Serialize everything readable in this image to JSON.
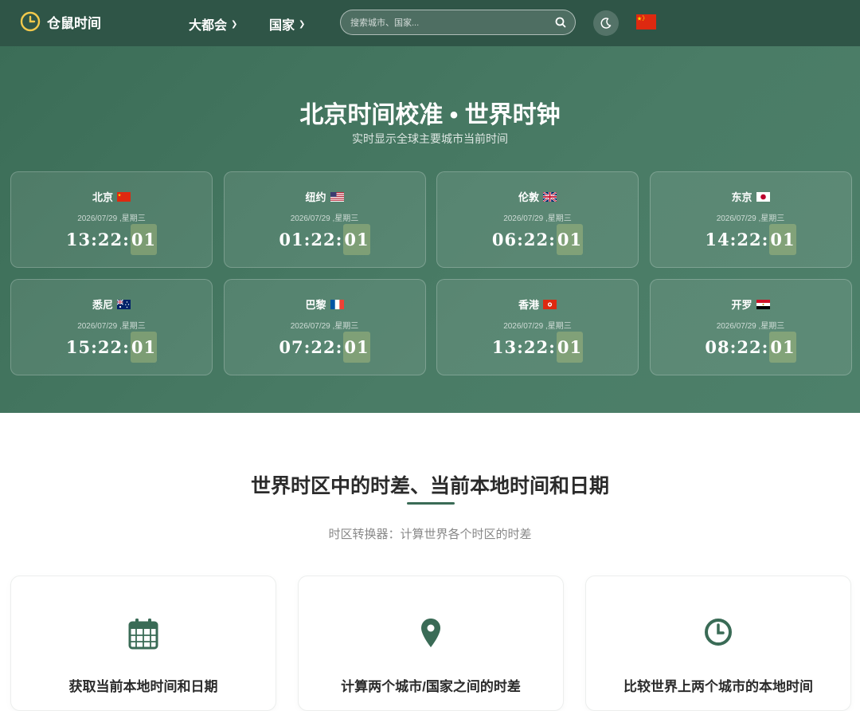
{
  "brand": {
    "name": "仓鼠时间"
  },
  "nav": {
    "menu": [
      {
        "label": "大都会"
      },
      {
        "label": "国家"
      }
    ],
    "search": {
      "placeholder": "搜索城市、国家..."
    },
    "flag": "china"
  },
  "hero": {
    "title": "北京时间校准 • 世界时钟",
    "subtitle": "实时显示全球主要城市当前时间",
    "clocks": [
      {
        "city": "北京",
        "flag": "china",
        "date": "2026/07/29 ,星期三",
        "hm": "13:22:",
        "sec": "01"
      },
      {
        "city": "纽约",
        "flag": "usa",
        "date": "2026/07/29 ,星期三",
        "hm": "01:22:",
        "sec": "01"
      },
      {
        "city": "伦敦",
        "flag": "uk",
        "date": "2026/07/29 ,星期三",
        "hm": "06:22:",
        "sec": "01"
      },
      {
        "city": "东京",
        "flag": "japan",
        "date": "2026/07/29 ,星期三",
        "hm": "14:22:",
        "sec": "01"
      },
      {
        "city": "悉尼",
        "flag": "australia",
        "date": "2026/07/29 ,星期三",
        "hm": "15:22:",
        "sec": "01"
      },
      {
        "city": "巴黎",
        "flag": "france",
        "date": "2026/07/29 ,星期三",
        "hm": "07:22:",
        "sec": "01"
      },
      {
        "city": "香港",
        "flag": "hongkong",
        "date": "2026/07/29 ,星期三",
        "hm": "13:22:",
        "sec": "01"
      },
      {
        "city": "开罗",
        "flag": "egypt",
        "date": "2026/07/29 ,星期三",
        "hm": "08:22:",
        "sec": "01"
      }
    ]
  },
  "section": {
    "title": "世界时区中的时差、当前本地时间和日期",
    "subtitle": "时区转换器：计算世界各个时区的时差",
    "features": [
      {
        "icon": "calendar-icon",
        "label": "获取当前本地时间和日期"
      },
      {
        "icon": "location-pin-icon",
        "label": "计算两个城市/国家之间的时差"
      },
      {
        "icon": "clock-icon",
        "label": "比较世界上两个城市的本地时间"
      }
    ]
  },
  "colors": {
    "nav_bg": "#2f5547",
    "hero_bg": "#4a7c66",
    "accent": "#3a6b56",
    "logo_yellow": "#f2c94c"
  }
}
